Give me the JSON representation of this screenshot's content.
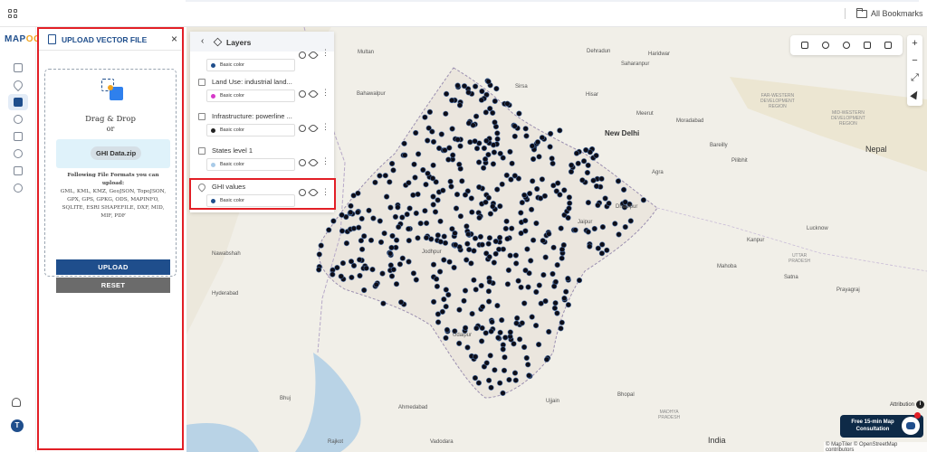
{
  "topbar": {
    "bookmarks_label": "All Bookmarks"
  },
  "rail": {
    "logo_text": "MAP",
    "logo_accent": "OG",
    "user_initial": "T"
  },
  "upload_panel": {
    "title": "UPLOAD VECTOR FILE",
    "close_label": "×",
    "drag_drop_label": "Drag & Drop",
    "or_label": "or",
    "file_name": "GHI Data.zip",
    "formats_heading": "Following File Formats you can upload:",
    "formats_list": "GML, KML, KMZ, GeoJSON, TopoJSON, GPX, GPS, GPKG, ODS, MAPINFO, SQLITE, ESRI SHAPEFILE, DXF, MID, MIF, PDF",
    "upload_button": "UPLOAD",
    "reset_button": "RESET"
  },
  "layers_panel": {
    "back_label": "‹",
    "title": "Layers",
    "layers": [
      {
        "name": "",
        "color_label": "Basic color",
        "swatch": "#1f4e8c"
      },
      {
        "name": "Land Use: industrial land...",
        "color_label": "Basic color",
        "swatch": "#d63ac9"
      },
      {
        "name": "Infrastructure: powerline ...",
        "color_label": "Basic color",
        "swatch": "#222222"
      },
      {
        "name": "States level 1",
        "color_label": "Basic color",
        "swatch": "#a9cbe8"
      },
      {
        "name": "GHI values",
        "color_label": "Basic color",
        "swatch": "#1f4e8c"
      }
    ]
  },
  "map": {
    "places": {
      "multan": "Multan",
      "bahawalpur": "Bahawalpur",
      "dehradun": "Dehradun",
      "saharanpur": "Saharanpur",
      "haridwar": "Haridwar",
      "sirsa": "Sirsa",
      "hisar": "Hisar",
      "meerut": "Meerut",
      "moradabad": "Moradabad",
      "new_delhi": "New Delhi",
      "bareilly": "Bareilly",
      "pilibhit": "Pilibhit",
      "agra": "Agra",
      "nawabshah": "Nawabshah",
      "hyderabad": "Hyderabad",
      "kanpur": "Kanpur",
      "lucknow": "Lucknow",
      "prayagraj": "Prayagraj",
      "bhuj": "Bhuj",
      "ahmedabad": "Ahmedabad",
      "ujjain": "Ujjain",
      "bhopal": "Bhopal",
      "rajkot": "Rajkot",
      "vadodara": "Vadodara",
      "india": "India",
      "nepal": "Nepal",
      "far_west": "FAR-WESTERN\nDEVELOPMENT\nREGION",
      "mid_west": "MID-WESTERN\nDEVELOPMENT\nREGION",
      "uttar_pradesh": "UTTAR\nPRADESH",
      "madhya_pradesh": "MADHYA\nPRADESH",
      "mahoba": "Mahoba",
      "satna": "Satna",
      "jaipur": "Jaipur",
      "jodhpur": "Jodhpur",
      "udaipur": "Udaipur",
      "dhaulpur": "Dhaulpur"
    },
    "attribution_label": "Attribution",
    "info_label": "i",
    "consultation": "Free 15-min Map Consultation",
    "copyright": "© MapTiler © OpenStreetMap contributors",
    "zoom_in": "+",
    "zoom_out": "−",
    "colors": {
      "land": "#f1efe8",
      "water": "#b9d3e6",
      "border": "#9b8fb0",
      "point": "#0d0d17"
    }
  }
}
